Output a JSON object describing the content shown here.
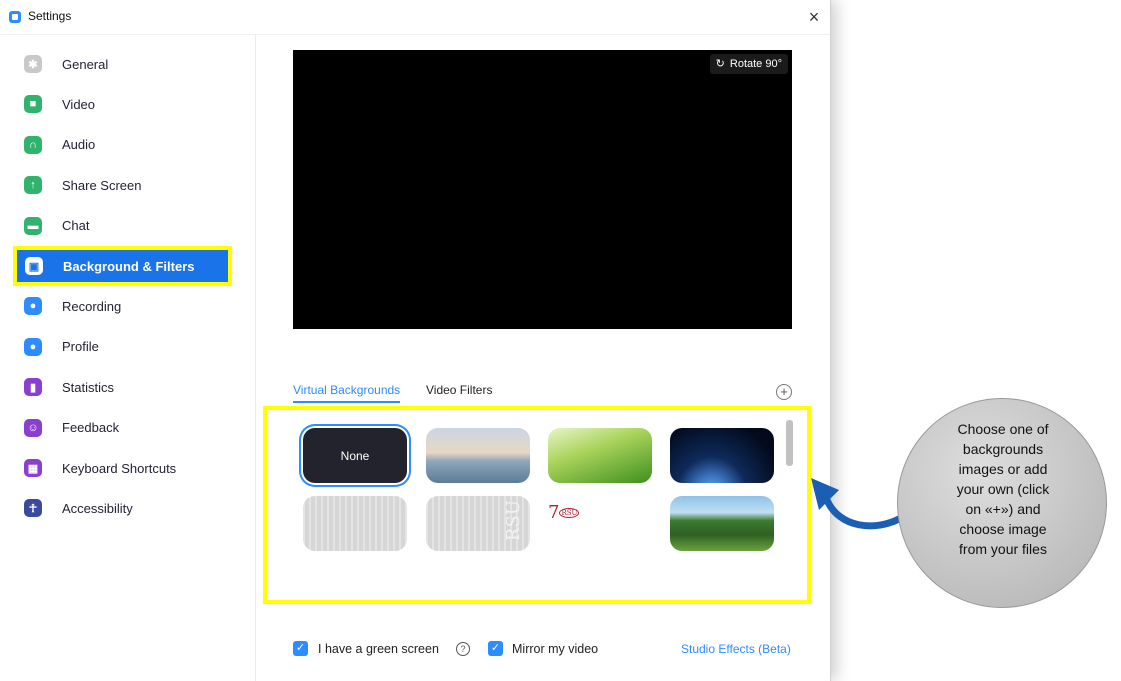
{
  "window": {
    "title": "Settings",
    "close_label": "×"
  },
  "sidebar": {
    "items": [
      {
        "label": "General",
        "icon": "gear-icon",
        "color": "#c9c9c9",
        "active": false
      },
      {
        "label": "Video",
        "icon": "video-icon",
        "color": "#2fb36d",
        "active": false
      },
      {
        "label": "Audio",
        "icon": "headphones-icon",
        "color": "#2fb36d",
        "active": false
      },
      {
        "label": "Share Screen",
        "icon": "share-screen-icon",
        "color": "#2fb36d",
        "active": false
      },
      {
        "label": "Chat",
        "icon": "chat-icon",
        "color": "#2fb36d",
        "active": false
      },
      {
        "label": "Background & Filters",
        "icon": "person-card-icon",
        "color": "#1a73e8",
        "active": true
      },
      {
        "label": "Recording",
        "icon": "record-icon",
        "color": "#2d8cff",
        "active": false
      },
      {
        "label": "Profile",
        "icon": "profile-icon",
        "color": "#2d8cff",
        "active": false
      },
      {
        "label": "Statistics",
        "icon": "bar-chart-icon",
        "color": "#8b3fd1",
        "active": false
      },
      {
        "label": "Feedback",
        "icon": "smile-icon",
        "color": "#8b3fd1",
        "active": false
      },
      {
        "label": "Keyboard Shortcuts",
        "icon": "keyboard-icon",
        "color": "#8b3fd1",
        "active": false
      },
      {
        "label": "Accessibility",
        "icon": "accessibility-icon",
        "color": "#3a4a9c",
        "active": false
      }
    ]
  },
  "preview": {
    "rotate_label": "Rotate 90°"
  },
  "tabs": [
    {
      "label": "Virtual Backgrounds",
      "active": true
    },
    {
      "label": "Video Filters",
      "active": false
    }
  ],
  "add_label": "+",
  "backgrounds": {
    "none_label": "None",
    "rsu_label": "RSU"
  },
  "footer": {
    "green_screen_label": "I have a green screen",
    "mirror_label": "Mirror my video",
    "studio_label": "Studio Effects (Beta)",
    "help_label": "?"
  },
  "annotation": {
    "text": "Choose one of backgrounds images or add your own (click on «+») and choose image from your files"
  },
  "colors": {
    "accent": "#2d8cff",
    "highlight": "#ffff00"
  }
}
